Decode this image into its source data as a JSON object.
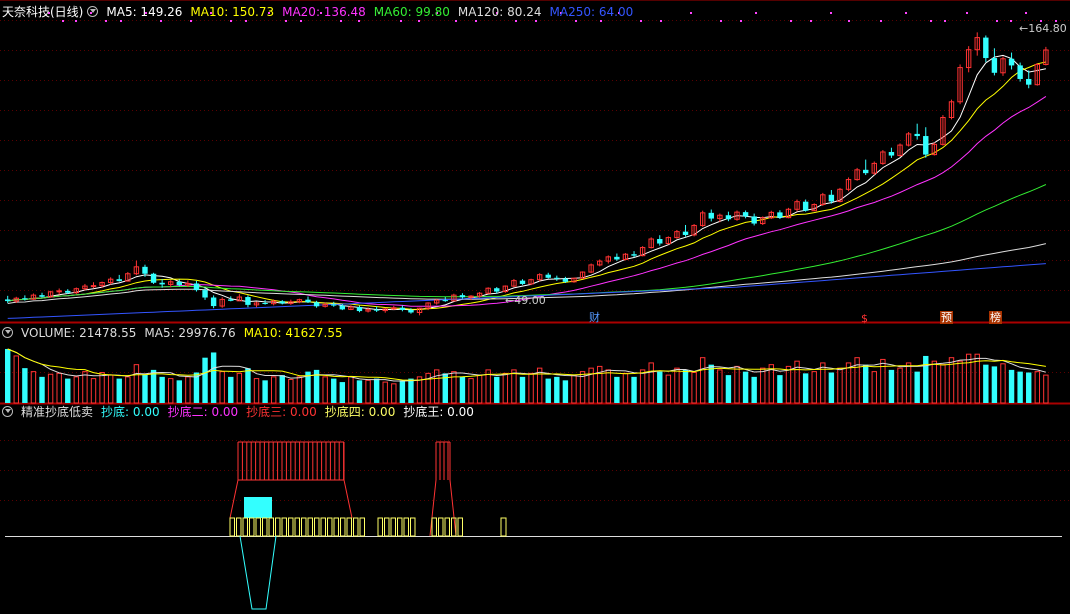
{
  "main_legend": {
    "title": "天奈科技(日线)",
    "items": [
      {
        "label": "MA5: 149.26",
        "color": "#ffffff"
      },
      {
        "label": "MA10: 150.73",
        "color": "#ffff00"
      },
      {
        "label": "MA20: 136.48",
        "color": "#ff33ff"
      },
      {
        "label": "MA60: 99.80",
        "color": "#33ee33"
      },
      {
        "label": "MA120: 80.24",
        "color": "#dddddd"
      },
      {
        "label": "MA250: 64.00",
        "color": "#3355ff"
      }
    ]
  },
  "volume_legend": {
    "items": [
      {
        "label": "VOLUME: 21478.55",
        "color": "#dddddd"
      },
      {
        "label": "MA5: 29976.76",
        "color": "#dddddd"
      },
      {
        "label": "MA10: 41627.55",
        "color": "#ffff00"
      }
    ]
  },
  "indicator_legend": {
    "title": "精准抄底低卖",
    "items": [
      {
        "label": "抄底: 0.00",
        "color": "#33ffff"
      },
      {
        "label": "抄底二: 0.00",
        "color": "#ff33ff"
      },
      {
        "label": "抄底三: 0.00",
        "color": "#ff3333"
      },
      {
        "label": "抄底四: 0.00",
        "color": "#ffff66"
      },
      {
        "label": "抄底王: 0.00",
        "color": "#ffffff"
      }
    ]
  },
  "price_labels": {
    "high": "164.80",
    "low": "49.00"
  },
  "event_tags": [
    {
      "text": "财",
      "color": "#5599ff",
      "bg": "#000000"
    },
    {
      "text": "$",
      "color": "#ff3333",
      "bg": "#000000"
    },
    {
      "text": "预",
      "color": "#ffffff",
      "bg": "#aa3300"
    },
    {
      "text": "榜",
      "color": "#ffffff",
      "bg": "#aa3300"
    }
  ],
  "colors": {
    "up": "#ff3333",
    "down": "#33ffff",
    "grid": "#5a0000",
    "axis": "#aa0000"
  },
  "chart_data": {
    "type": "candlestick",
    "price_range": [
      43,
      170
    ],
    "candles": [
      [
        52.5,
        54.0,
        51.0,
        51.8
      ],
      [
        51.8,
        53.6,
        51.0,
        53.0
      ],
      [
        53.0,
        54.2,
        52.0,
        52.6
      ],
      [
        52.6,
        55.0,
        52.3,
        54.3
      ],
      [
        54.3,
        55.3,
        53.2,
        53.6
      ],
      [
        53.6,
        56.1,
        53.2,
        55.7
      ],
      [
        55.7,
        57.1,
        54.5,
        56.1
      ],
      [
        56.1,
        56.8,
        54.8,
        55.3
      ],
      [
        55.3,
        57.5,
        54.8,
        57.0
      ],
      [
        57.0,
        59.0,
        56.3,
        58.1
      ],
      [
        58.1,
        59.7,
        57.2,
        58.3
      ],
      [
        58.3,
        60.0,
        57.4,
        59.6
      ],
      [
        59.6,
        61.8,
        58.7,
        61.0
      ],
      [
        61.0,
        62.8,
        60.0,
        60.2
      ],
      [
        60.2,
        64.0,
        60.0,
        63.3
      ],
      [
        63.3,
        68.8,
        62.7,
        66.2
      ],
      [
        66.2,
        67.1,
        62.0,
        63.3
      ],
      [
        63.3,
        63.7,
        59.0,
        59.5
      ],
      [
        59.5,
        61.1,
        57.4,
        58.8
      ],
      [
        58.8,
        60.6,
        57.6,
        59.9
      ],
      [
        59.9,
        60.9,
        58.0,
        58.5
      ],
      [
        58.5,
        60.5,
        57.7,
        59.2
      ],
      [
        59.2,
        60.3,
        55.8,
        56.4
      ],
      [
        56.4,
        57.3,
        52.3,
        53.3
      ],
      [
        53.3,
        54.2,
        48.8,
        49.7
      ],
      [
        49.7,
        53.4,
        49.0,
        52.5
      ],
      [
        52.5,
        53.8,
        51.7,
        51.9
      ],
      [
        51.9,
        54.7,
        51.8,
        53.5
      ],
      [
        53.5,
        54.2,
        49.2,
        50.2
      ],
      [
        50.2,
        51.6,
        49.2,
        51.0
      ],
      [
        51.0,
        52.2,
        50.3,
        50.7
      ],
      [
        50.7,
        52.5,
        50.0,
        51.7
      ],
      [
        51.7,
        52.2,
        50.4,
        50.8
      ],
      [
        50.8,
        52.4,
        50.2,
        51.5
      ],
      [
        51.5,
        52.8,
        50.9,
        52.4
      ],
      [
        52.4,
        53.7,
        51.0,
        51.3
      ],
      [
        51.3,
        51.9,
        49.0,
        49.6
      ],
      [
        49.6,
        51.2,
        49.1,
        50.4
      ],
      [
        50.4,
        51.5,
        49.4,
        49.9
      ],
      [
        49.9,
        50.6,
        48.0,
        48.3
      ],
      [
        48.3,
        50.1,
        48.0,
        49.3
      ],
      [
        49.3,
        49.9,
        47.1,
        47.6
      ],
      [
        47.6,
        49.2,
        47.0,
        48.2
      ],
      [
        48.2,
        49.5,
        47.2,
        47.8
      ],
      [
        47.8,
        48.9,
        46.9,
        48.5
      ],
      [
        48.5,
        49.8,
        48.1,
        49.0
      ],
      [
        49.0,
        50.0,
        47.5,
        48.1
      ],
      [
        48.1,
        48.8,
        46.5,
        47.0
      ],
      [
        47.0,
        49.0,
        45.8,
        48.8
      ],
      [
        48.8,
        51.3,
        48.0,
        51.0
      ],
      [
        51.0,
        52.6,
        50.3,
        52.2
      ],
      [
        52.2,
        53.5,
        51.5,
        51.9
      ],
      [
        51.9,
        54.9,
        51.7,
        54.3
      ],
      [
        54.3,
        55.1,
        52.8,
        53.4
      ],
      [
        53.4,
        54.3,
        52.2,
        53.9
      ],
      [
        53.9,
        55.6,
        53.2,
        55.1
      ],
      [
        55.1,
        57.6,
        54.9,
        57.2
      ],
      [
        57.2,
        57.7,
        55.0,
        55.8
      ],
      [
        55.8,
        58.4,
        55.3,
        58.1
      ],
      [
        58.1,
        61.1,
        57.7,
        60.4
      ],
      [
        60.4,
        61.0,
        58.6,
        59.0
      ],
      [
        59.0,
        61.2,
        58.5,
        60.8
      ],
      [
        60.8,
        63.5,
        60.1,
        62.9
      ],
      [
        62.9,
        63.7,
        61.3,
        61.6
      ],
      [
        61.6,
        62.5,
        60.3,
        61.2
      ],
      [
        61.2,
        62.0,
        59.4,
        59.9
      ],
      [
        59.9,
        61.7,
        59.5,
        61.4
      ],
      [
        61.4,
        64.3,
        61.3,
        64.0
      ],
      [
        64.0,
        67.6,
        63.6,
        67.0
      ],
      [
        67.0,
        69.3,
        66.4,
        68.6
      ],
      [
        68.6,
        71.0,
        67.6,
        70.4
      ],
      [
        70.4,
        71.8,
        68.7,
        69.3
      ],
      [
        69.3,
        72.0,
        68.9,
        71.5
      ],
      [
        71.5,
        72.8,
        70.3,
        70.9
      ],
      [
        70.9,
        74.9,
        70.6,
        74.3
      ],
      [
        74.3,
        78.6,
        73.9,
        77.9
      ],
      [
        77.9,
        79.5,
        75.1,
        76.0
      ],
      [
        76.0,
        79.0,
        75.6,
        78.5
      ],
      [
        78.5,
        81.7,
        78.0,
        81.0
      ],
      [
        81.0,
        83.8,
        78.9,
        79.6
      ],
      [
        79.6,
        84.2,
        79.0,
        83.6
      ],
      [
        83.6,
        89.8,
        83.0,
        88.9
      ],
      [
        88.9,
        90.3,
        85.3,
        86.5
      ],
      [
        86.5,
        88.6,
        85.0,
        87.9
      ],
      [
        87.9,
        89.4,
        85.4,
        86.2
      ],
      [
        86.2,
        89.9,
        85.6,
        89.2
      ],
      [
        89.2,
        89.9,
        86.6,
        87.4
      ],
      [
        87.4,
        88.6,
        83.6,
        84.4
      ],
      [
        84.4,
        87.4,
        83.8,
        86.8
      ],
      [
        86.8,
        89.8,
        86.3,
        89.1
      ],
      [
        89.1,
        90.0,
        86.3,
        86.9
      ],
      [
        86.9,
        91.0,
        86.6,
        90.4
      ],
      [
        90.4,
        94.5,
        89.5,
        93.6
      ],
      [
        93.6,
        94.5,
        89.4,
        89.8
      ],
      [
        89.8,
        92.9,
        89.6,
        92.4
      ],
      [
        92.4,
        97.3,
        91.8,
        96.5
      ],
      [
        96.5,
        98.5,
        92.8,
        93.7
      ],
      [
        93.7,
        99.4,
        93.3,
        98.8
      ],
      [
        98.8,
        103.8,
        98.0,
        102.9
      ],
      [
        102.9,
        107.8,
        102.4,
        107.0
      ],
      [
        107.0,
        111.3,
        104.8,
        105.6
      ],
      [
        105.6,
        110.5,
        104.8,
        109.7
      ],
      [
        109.7,
        115.3,
        109.1,
        114.5
      ],
      [
        114.5,
        116.3,
        112.0,
        113.0
      ],
      [
        113.0,
        118.1,
        112.6,
        117.4
      ],
      [
        117.4,
        122.9,
        116.8,
        122.1
      ],
      [
        122.1,
        126.4,
        119.7,
        121.2
      ],
      [
        121.2,
        124.9,
        112.1,
        113.4
      ],
      [
        113.4,
        118.5,
        113.0,
        117.7
      ],
      [
        117.7,
        130.0,
        117.2,
        129.0
      ],
      [
        129.0,
        136.5,
        128.2,
        135.6
      ],
      [
        135.6,
        151.3,
        134.6,
        150.0
      ],
      [
        150.0,
        159.0,
        148.0,
        157.5
      ],
      [
        157.5,
        164.8,
        155.0,
        162.6
      ],
      [
        162.6,
        163.5,
        152.3,
        154.0
      ],
      [
        154.0,
        158.1,
        146.7,
        147.8
      ],
      [
        147.8,
        154.7,
        146.5,
        153.7
      ],
      [
        153.7,
        156.3,
        149.2,
        150.9
      ],
      [
        150.9,
        152.1,
        144.1,
        145.2
      ],
      [
        145.2,
        148.8,
        141.3,
        142.8
      ],
      [
        142.8,
        151.9,
        142.4,
        151.3
      ],
      [
        151.3,
        158.7,
        150.9,
        157.4
      ]
    ],
    "volume": [
      62,
      54,
      40,
      36,
      30,
      33,
      34,
      28,
      30,
      36,
      28,
      35,
      32,
      28,
      30,
      44,
      33,
      38,
      30,
      28,
      26,
      30,
      35,
      52,
      58,
      36,
      30,
      34,
      40,
      28,
      26,
      30,
      32,
      27,
      30,
      36,
      38,
      30,
      28,
      24,
      30,
      26,
      26,
      28,
      24,
      22,
      26,
      28,
      30,
      34,
      38,
      34,
      36,
      30,
      28,
      32,
      38,
      30,
      34,
      38,
      30,
      34,
      40,
      28,
      30,
      26,
      32,
      36,
      40,
      42,
      38,
      30,
      34,
      30,
      38,
      46,
      36,
      32,
      40,
      38,
      35,
      52,
      44,
      38,
      32,
      42,
      36,
      30,
      40,
      44,
      32,
      42,
      48,
      34,
      36,
      46,
      35,
      40,
      46,
      52,
      44,
      36,
      50,
      38,
      40,
      46,
      36,
      54,
      48,
      44,
      52,
      48,
      56,
      56,
      44,
      42,
      45,
      38,
      36,
      35,
      36,
      32
    ],
    "vol_range": [
      0,
      70
    ]
  }
}
